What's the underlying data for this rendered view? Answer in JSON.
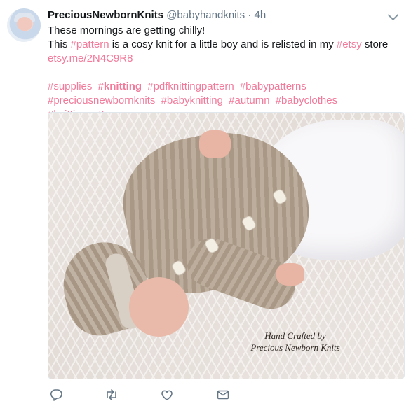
{
  "tweet": {
    "display_name": "PreciousNewbornKnits",
    "handle": "@babyhandknits",
    "separator": "·",
    "time": "4h",
    "line1": "These mornings are getting chilly!",
    "line2_pre": "This ",
    "line2_tag1": "#pattern",
    "line2_mid": " is a cosy knit for a little boy and is relisted in my ",
    "line2_tag2": "#etsy",
    "line2_post": " store",
    "link": "etsy.me/2N4C9R8",
    "hashtags": [
      "#supplies",
      "#knitting",
      "#pdfknittingpattern",
      "#babypatterns",
      "#preciousnewbornknits",
      "#babyknitting",
      "#autumn",
      "#babyclothes",
      "#knittingpattern"
    ]
  },
  "image": {
    "watermark_line1": "Hand Crafted by",
    "watermark_line2": "Precious Newborn Knits"
  },
  "actions": {
    "icons": [
      "reply-icon",
      "retweet-icon",
      "like-icon",
      "dm-icon"
    ]
  },
  "colors": {
    "link": "#f27a9b",
    "muted": "#657786",
    "text": "#14171a"
  }
}
